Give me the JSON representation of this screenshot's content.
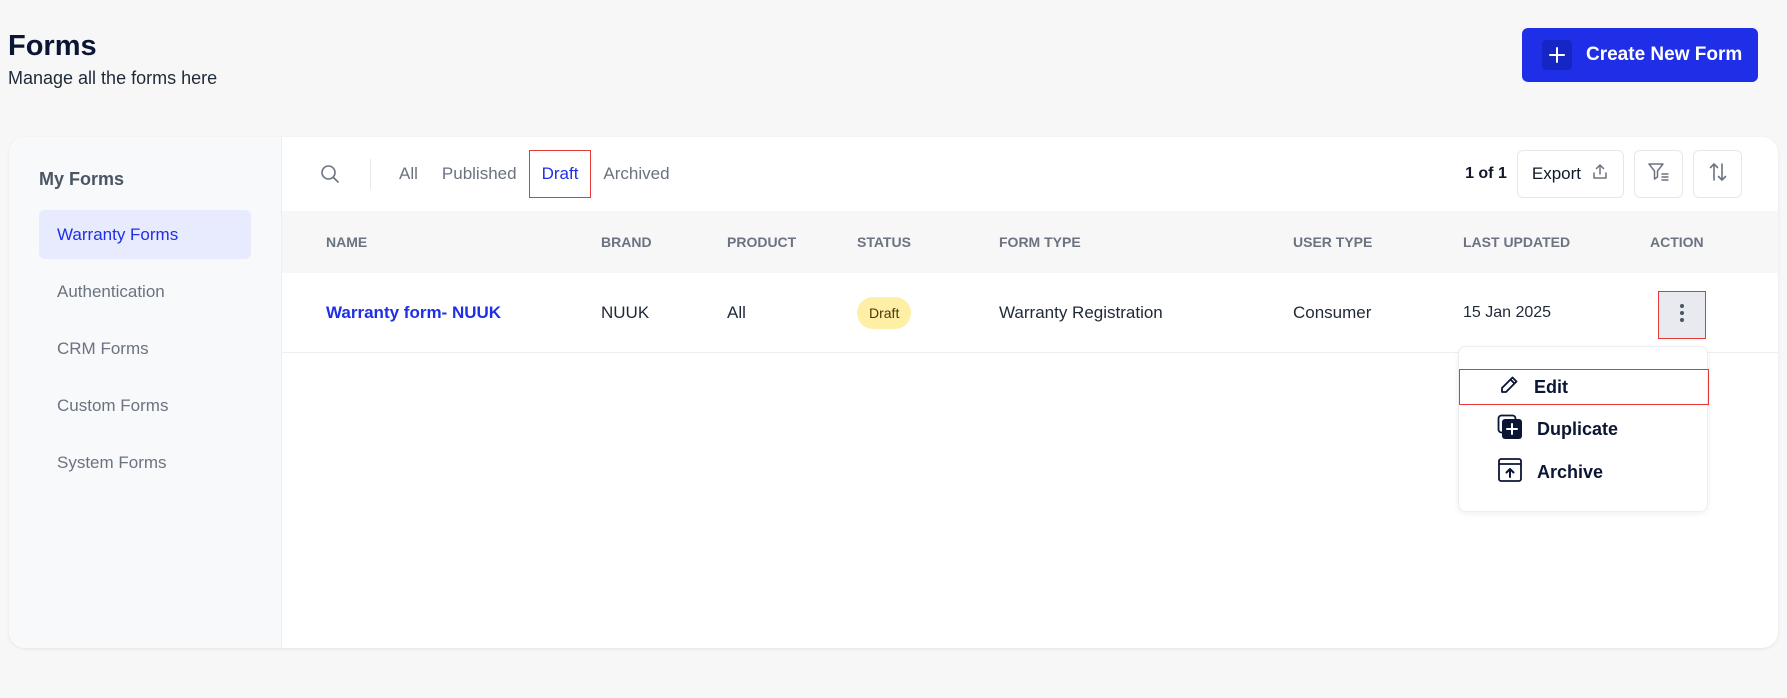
{
  "header": {
    "title": "Forms",
    "subtitle": "Manage all the forms here",
    "create_button_label": "Create New Form"
  },
  "sidebar": {
    "title": "My Forms",
    "items": [
      {
        "label": "Warranty Forms",
        "active": true
      },
      {
        "label": "Authentication"
      },
      {
        "label": "CRM Forms"
      },
      {
        "label": "Custom Forms"
      },
      {
        "label": "System Forms"
      }
    ]
  },
  "tabs": [
    {
      "label": "All"
    },
    {
      "label": "Published"
    },
    {
      "label": "Draft",
      "active": true
    },
    {
      "label": "Archived"
    }
  ],
  "toolbar": {
    "page_count": "1 of 1",
    "export_label": "Export"
  },
  "table": {
    "columns": [
      "NAME",
      "BRAND",
      "PRODUCT",
      "STATUS",
      "FORM TYPE",
      "USER TYPE",
      "LAST UPDATED",
      "ACTION"
    ],
    "rows": [
      {
        "name": "Warranty form- NUUK",
        "brand": "NUUK",
        "product": "All",
        "status": "Draft",
        "form_type": "Warranty Registration",
        "user_type": "Consumer",
        "last_updated": "15 Jan 2025"
      }
    ]
  },
  "action_menu": {
    "items": [
      {
        "label": "Edit",
        "icon": "pencil-icon"
      },
      {
        "label": "Duplicate",
        "icon": "duplicate-icon"
      },
      {
        "label": "Archive",
        "icon": "archive-icon"
      }
    ]
  },
  "colors": {
    "accent": "#1f2fe8",
    "draft_badge_bg": "#fdefa5",
    "highlight_border": "#e53935"
  }
}
